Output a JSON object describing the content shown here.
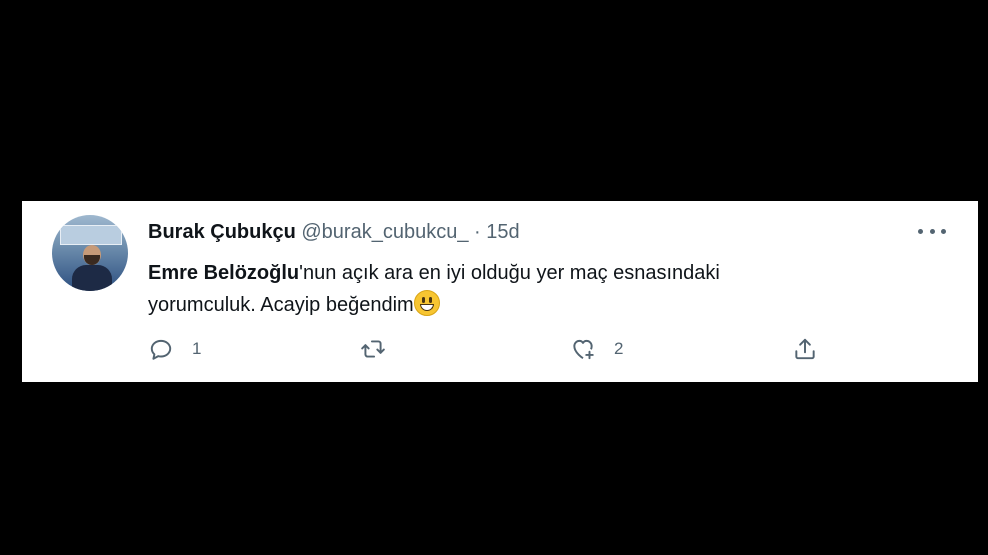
{
  "tweet": {
    "author": {
      "display_name": "Burak Çubukçu",
      "handle": "@burak_cubukcu_",
      "separator": " · ",
      "time": "15d"
    },
    "text": {
      "mention": "Emre Belözoğlu",
      "line1_rest": "'nun açık ara en iyi olduğu yer maç esnasındaki",
      "line2": "yorumculuk. Acayip beğendim",
      "emoji": "grinning-face-emoji"
    },
    "actions": {
      "reply": {
        "icon": "reply-icon",
        "count": "1"
      },
      "retweet": {
        "icon": "retweet-icon",
        "count": ""
      },
      "like": {
        "icon": "heart-icon",
        "count": "2"
      },
      "share": {
        "icon": "share-icon",
        "count": ""
      }
    },
    "more_icon": "more-horizontal-icon"
  },
  "colors": {
    "background": "#000000",
    "card": "#ffffff",
    "text_primary": "#0f1419",
    "text_secondary": "#536471"
  }
}
